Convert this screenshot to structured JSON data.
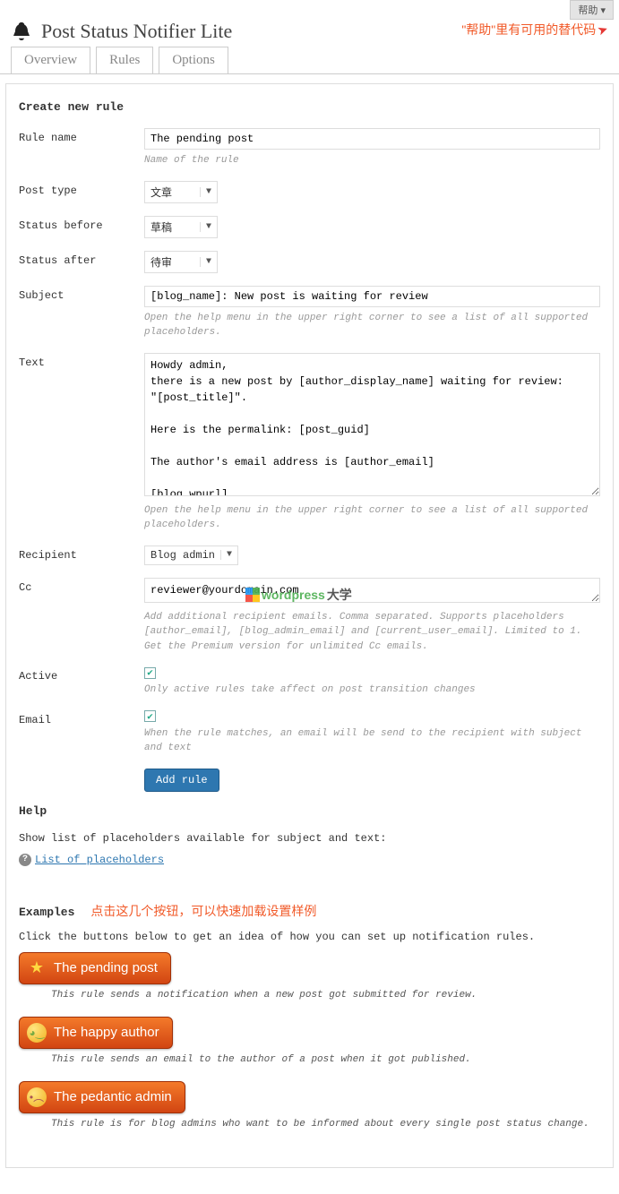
{
  "topbar": {
    "help_btn": "帮助 ▾"
  },
  "annotation1": "\"帮助\"里有可用的替代码",
  "page_title": "Post Status Notifier Lite",
  "tabs": {
    "overview": "Overview",
    "rules": "Rules",
    "options": "Options"
  },
  "section_create": "Create new rule",
  "fields": {
    "rule_name": {
      "label": "Rule name",
      "value": "The pending post",
      "hint": "Name of the rule"
    },
    "post_type": {
      "label": "Post type",
      "value": "文章"
    },
    "status_before": {
      "label": "Status before",
      "value": "草稿"
    },
    "status_after": {
      "label": "Status after",
      "value": "待审"
    },
    "subject": {
      "label": "Subject",
      "value": "[blog_name]: New post is waiting for review",
      "hint": "Open the help menu in the upper right corner to see a list of all supported placeholders."
    },
    "text": {
      "label": "Text",
      "value": "Howdy admin,\nthere is a new post by [author_display_name] waiting for review:\n\"[post_title]\".\n\nHere is the permalink: [post_guid]\n\nThe author's email address is [author_email]\n\n[blog_wpurl]",
      "hint": "Open the help menu in the upper right corner to see a list of all supported placeholders."
    },
    "recipient": {
      "label": "Recipient",
      "value": "Blog admin"
    },
    "cc": {
      "label": "Cc",
      "value": "reviewer@yourdomain.com",
      "hint": "Add additional recipient emails. Comma separated. Supports placeholders [author_email], [blog_admin_email] and [current_user_email]. Limited to 1. Get the Premium version for unlimited Cc emails."
    },
    "active": {
      "label": "Active",
      "hint": "Only active rules take affect on post transition changes"
    },
    "email": {
      "label": "Email",
      "hint": "When the rule matches, an email will be send to the recipient with subject and text"
    }
  },
  "add_rule_btn": "Add rule",
  "help": {
    "heading": "Help",
    "text": "Show list of placeholders available for subject and text:",
    "link": "List of placeholders"
  },
  "watermark": {
    "text1": "wordpress",
    "text2": "大学"
  },
  "examples": {
    "heading": "Examples",
    "annotation": "点击这几个按钮，可以快速加载设置样例",
    "intro": "Click the buttons below to get an idea of how you can set up notification rules.",
    "items": [
      {
        "label": "The pending post",
        "desc": "This rule sends a notification when a new post got submitted for review."
      },
      {
        "label": "The happy author",
        "desc": "This rule sends an email to the author of a post when it got published."
      },
      {
        "label": "The pedantic admin",
        "desc": "This rule is for blog admins who want to be informed about every single post status change."
      }
    ]
  }
}
